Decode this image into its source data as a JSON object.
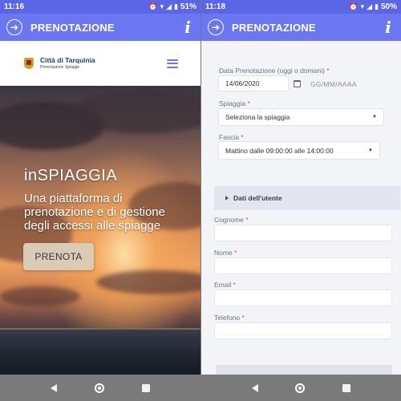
{
  "left": {
    "status": {
      "time": "11:16",
      "battery": "51%"
    },
    "appbar": {
      "title": "PRENOTAZIONE",
      "info_label": "i",
      "nav_icon": "arrow-right-circle-icon"
    },
    "site": {
      "name": "Città di Tarquinia",
      "subtitle": "Prenotazione Spiagge"
    },
    "hero": {
      "title": "inSPIAGGIA",
      "subtitle": "Una piattaforma di prenotazione e di gestione degli accessi alle spiagge",
      "button": "PRENOTA"
    }
  },
  "right": {
    "status": {
      "time": "11:18",
      "battery": "50%"
    },
    "appbar": {
      "title": "PRENOTAZIONE",
      "info_label": "i",
      "nav_icon": "arrow-right-circle-icon"
    },
    "form": {
      "date_label": "Data Prenotazione (oggi o domani)",
      "date_value": "14/06/2020",
      "date_format_placeholder": "GG/MM/AAAA",
      "beach_label": "Spiaggia",
      "beach_value": "Seleziona la spiaggia",
      "slot_label": "Fascia",
      "slot_value": "Mattino dalle 09:00:00 alle 14:00:00"
    },
    "user_section": {
      "title": "Dati dell'utente",
      "surname_label": "Cognome",
      "name_label": "Nome",
      "email_label": "Email",
      "phone_label": "Telefono"
    }
  },
  "required_marker": "*",
  "colors": {
    "appbar": "#6b77f2",
    "statusbar": "#5a66e6",
    "required": "#d9534f",
    "hero_button": "#d9cbb5"
  }
}
